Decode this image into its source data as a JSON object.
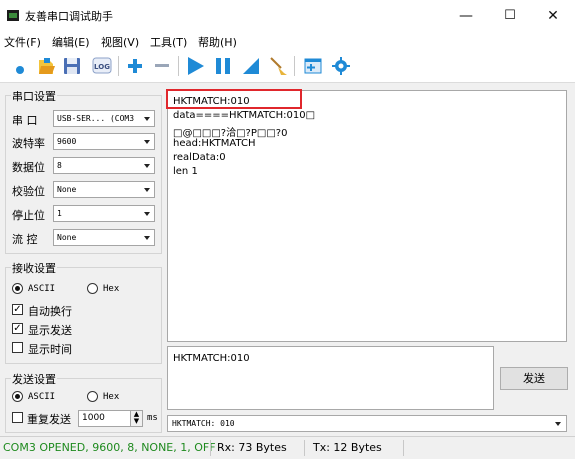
{
  "window": {
    "title": "友善串口调试助手",
    "minimize_glyph": "—",
    "maximize_glyph": "☐",
    "close_glyph": "✕"
  },
  "menu": [
    "文件(F)",
    "编辑(E)",
    "视图(V)",
    "工具(T)",
    "帮助(H)"
  ],
  "toolbar": {
    "icons": [
      "new-icon",
      "open-icon",
      "save-icon",
      "log-icon",
      "add-icon",
      "remove-icon",
      "play-icon",
      "pause-icon",
      "clear-icon",
      "broom-icon",
      "window-icon",
      "settings-icon"
    ],
    "log_text": "LOG"
  },
  "serial_settings": {
    "title": "串口设置",
    "port_label": "串  口",
    "port_value": "USB-SER... (COM3",
    "baud_label": "波特率",
    "baud_value": "9600",
    "databits_label": "数据位",
    "databits_value": "8",
    "parity_label": "校验位",
    "parity_value": "None",
    "stopbits_label": "停止位",
    "stopbits_value": "1",
    "flow_label": "流  控",
    "flow_value": "None"
  },
  "receive_settings": {
    "title": "接收设置",
    "ascii_label": "ASCII",
    "hex_label": "Hex",
    "ascii_selected": true,
    "auto_newline_label": "自动换行",
    "auto_newline_checked": true,
    "show_send_label": "显示发送",
    "show_send_checked": true,
    "show_time_label": "显示时间",
    "show_time_checked": false
  },
  "send_settings": {
    "title": "发送设置",
    "ascii_label": "ASCII",
    "hex_label": "Hex",
    "ascii_selected": true,
    "repeat_label": "重复发送",
    "repeat_checked": false,
    "interval_value": "1000",
    "interval_unit": "ms"
  },
  "receive_area": {
    "lines": [
      "HKTMATCH:010",
      "data====HKTMATCH:010□",
      "□@□□□?洽□?P□□?0",
      "head:HKTMATCH",
      "realData:0",
      "len 1"
    ]
  },
  "send_area": {
    "text": "HKTMATCH:010",
    "send_button": "发送"
  },
  "history_combo": {
    "value": "HKTMATCH: 010"
  },
  "status": {
    "connection": "COM3 OPENED, 9600, 8, NONE, 1, OFF",
    "rx": "Rx: 73 Bytes",
    "tx": "Tx: 12 Bytes"
  },
  "colors": {
    "status_green": "#1e8a1e",
    "highlight_red": "#e0272c",
    "toolbar_blue": "#1f8ad6"
  }
}
